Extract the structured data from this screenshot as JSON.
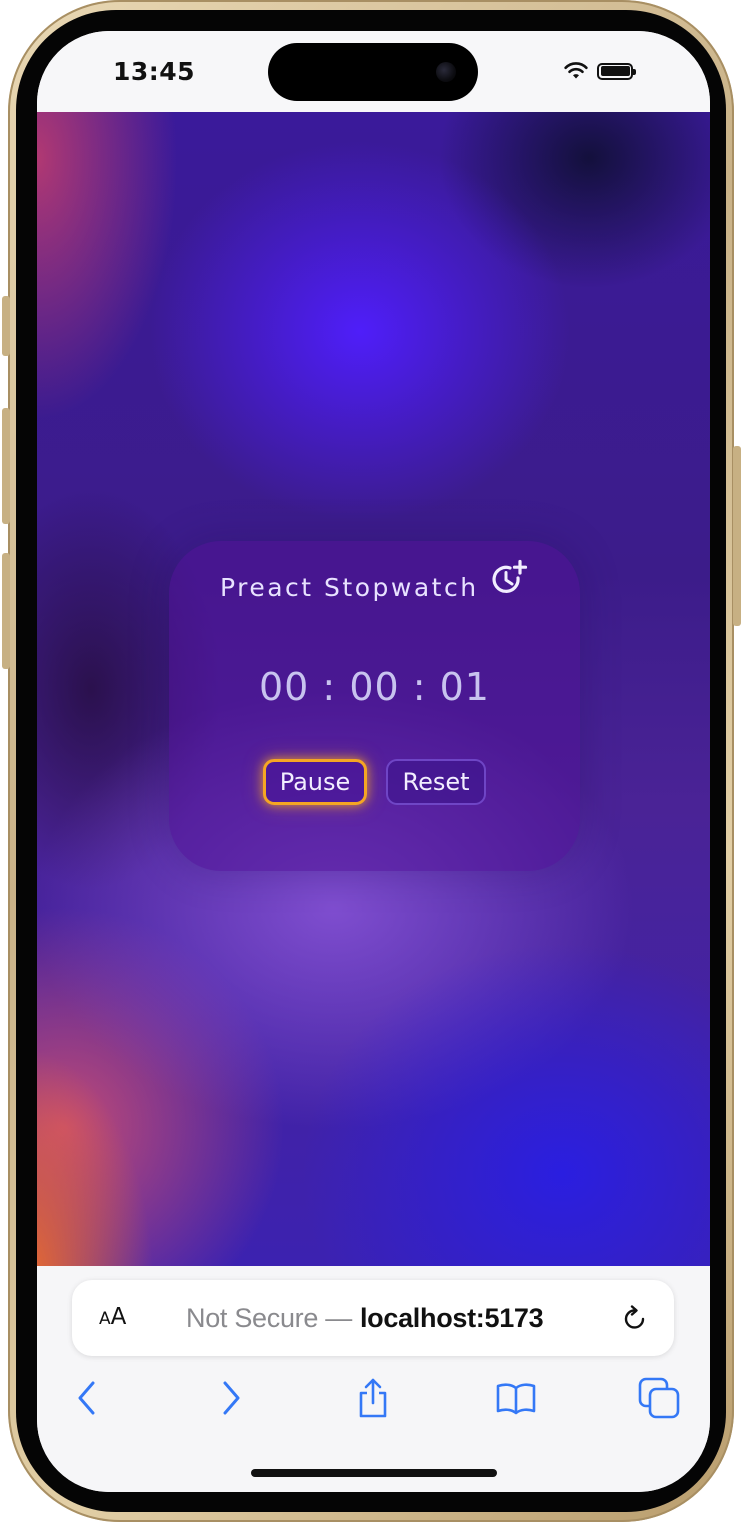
{
  "status_bar": {
    "time": "13:45",
    "icons": [
      "wifi-icon",
      "battery-icon"
    ]
  },
  "app": {
    "title": "Preact Stopwatch",
    "title_icon": "timer-plus-icon",
    "time_display": "00 : 00 : 01",
    "buttons": {
      "pause": "Pause",
      "reset": "Reset"
    },
    "colors": {
      "pause_border": "#f5a623",
      "card_background": "#50129680",
      "text": "#e8e2ff"
    }
  },
  "browser": {
    "text_size_label_small": "A",
    "text_size_label_large": "A",
    "security_label": "Not Secure —",
    "domain": "localhost:5173",
    "toolbar": [
      "back-icon",
      "forward-icon",
      "share-icon",
      "bookmarks-icon",
      "tabs-icon"
    ],
    "accent_color": "#3478f6"
  }
}
